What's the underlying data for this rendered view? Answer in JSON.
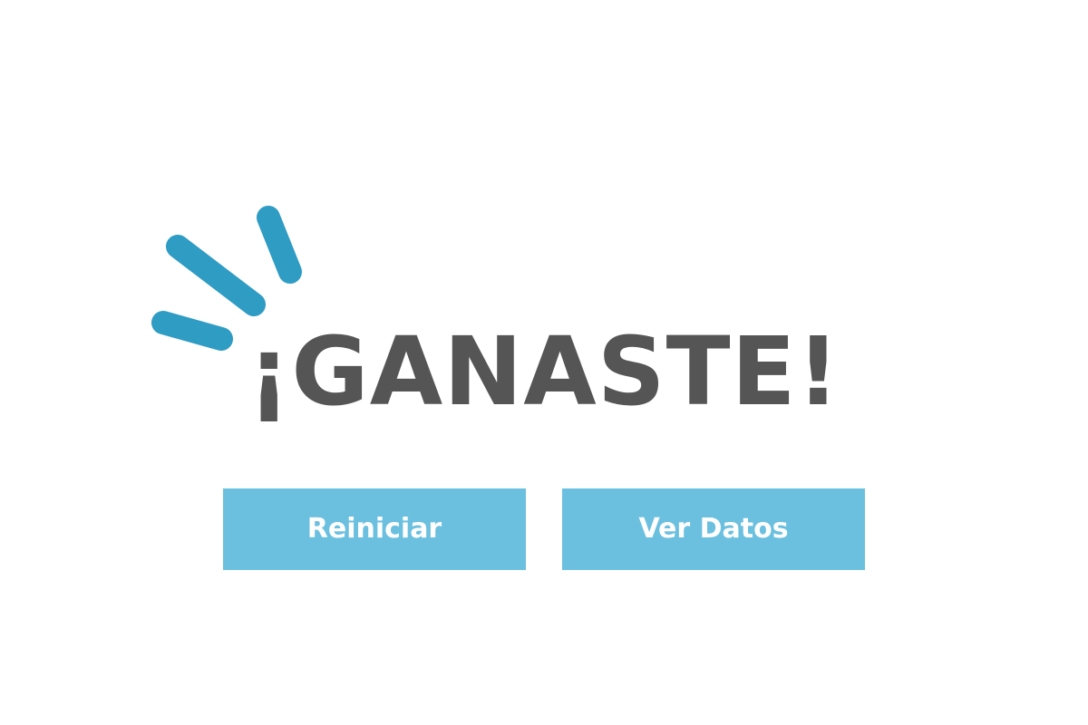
{
  "screen": {
    "title": "¡GANASTE!",
    "accent_color": "#2f9cc4",
    "button_color": "#6cc0df",
    "title_color": "#555555"
  },
  "buttons": {
    "restart_label": "Reiniciar",
    "view_data_label": "Ver Datos"
  },
  "decoration": {
    "icon": "celebration-burst-icon"
  }
}
